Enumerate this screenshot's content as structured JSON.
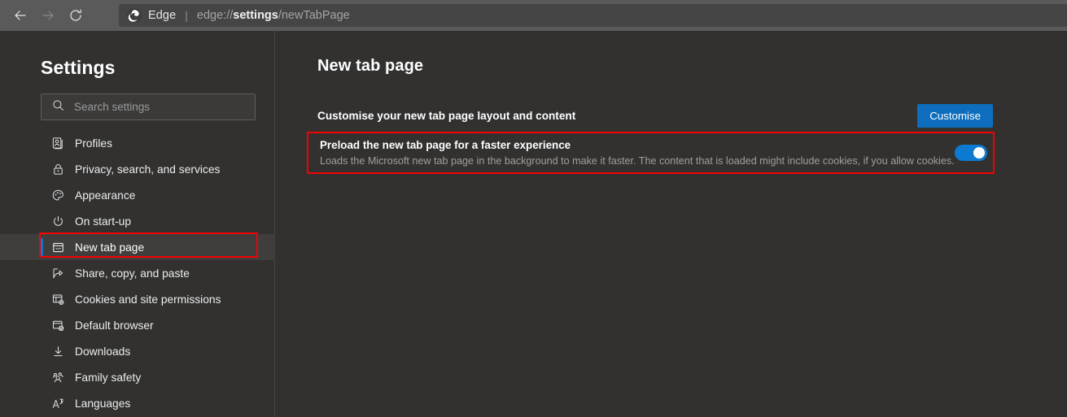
{
  "browser": {
    "back_icon": "back-arrow-icon",
    "forward_icon": "forward-arrow-icon",
    "reload_icon": "reload-icon",
    "brand_label": "Edge",
    "separator": "|",
    "url_prefix": "edge://",
    "url_bold": "settings",
    "url_suffix": "/newTabPage",
    "url_full": "edge://settings/newTabPage"
  },
  "sidebar": {
    "title": "Settings",
    "search": {
      "placeholder": "Search settings",
      "value": "",
      "icon": "search-icon"
    },
    "items": [
      {
        "label": "Profiles",
        "icon": "profiles-icon",
        "selected": false
      },
      {
        "label": "Privacy, search, and services",
        "icon": "lock-icon",
        "selected": false
      },
      {
        "label": "Appearance",
        "icon": "palette-icon",
        "selected": false
      },
      {
        "label": "On start-up",
        "icon": "power-icon",
        "selected": false
      },
      {
        "label": "New tab page",
        "icon": "new-tab-page-icon",
        "selected": true
      },
      {
        "label": "Share, copy, and paste",
        "icon": "share-icon",
        "selected": false
      },
      {
        "label": "Cookies and site permissions",
        "icon": "cookies-icon",
        "selected": false
      },
      {
        "label": "Default browser",
        "icon": "default-browser-icon",
        "selected": false
      },
      {
        "label": "Downloads",
        "icon": "download-icon",
        "selected": false
      },
      {
        "label": "Family safety",
        "icon": "family-safety-icon",
        "selected": false
      },
      {
        "label": "Languages",
        "icon": "languages-icon",
        "selected": false
      }
    ]
  },
  "main": {
    "page_title": "New tab page",
    "customise_section": {
      "label": "Customise your new tab page layout and content",
      "button_label": "Customise"
    },
    "preload_setting": {
      "title": "Preload the new tab page for a faster experience",
      "description": "Loads the Microsoft new tab page in the background to make it faster. The content that is loaded might include cookies, if you allow cookies.",
      "toggle_state": "on"
    }
  },
  "colors": {
    "accent": "#0e79d0",
    "button": "#0e6ebd",
    "annotation": "#f50000",
    "page_bg": "#323130",
    "toolbar_bg": "#5a5a5a",
    "address_bg": "#454545"
  }
}
